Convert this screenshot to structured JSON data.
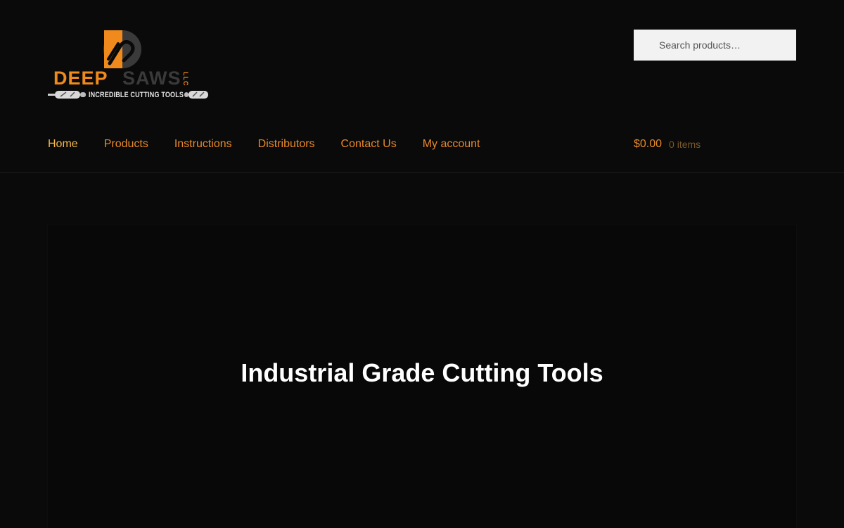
{
  "branding": {
    "name_primary": "DEEP",
    "name_secondary": "SAWS",
    "suffix": "LLC",
    "tagline": "INCREDIBLE CUTTING TOOLS",
    "logo_icon": "saw-blade-logo-icon",
    "colors": {
      "orange": "#f08a1c",
      "dark_gray": "#3a3a3a"
    }
  },
  "search": {
    "placeholder": "Search products…"
  },
  "nav": {
    "items": [
      {
        "label": "Home",
        "active": true
      },
      {
        "label": "Products"
      },
      {
        "label": "Instructions"
      },
      {
        "label": "Distributors"
      },
      {
        "label": "Contact Us"
      },
      {
        "label": "My account"
      }
    ]
  },
  "cart": {
    "amount": "$0.00",
    "count": "0 items"
  },
  "hero": {
    "title": "Industrial Grade Cutting Tools"
  },
  "theme": {
    "background": "#0a0a0a",
    "link_color": "#e8892a",
    "active_link_color": "#f5b84a",
    "hero_text": "#ffffff"
  }
}
